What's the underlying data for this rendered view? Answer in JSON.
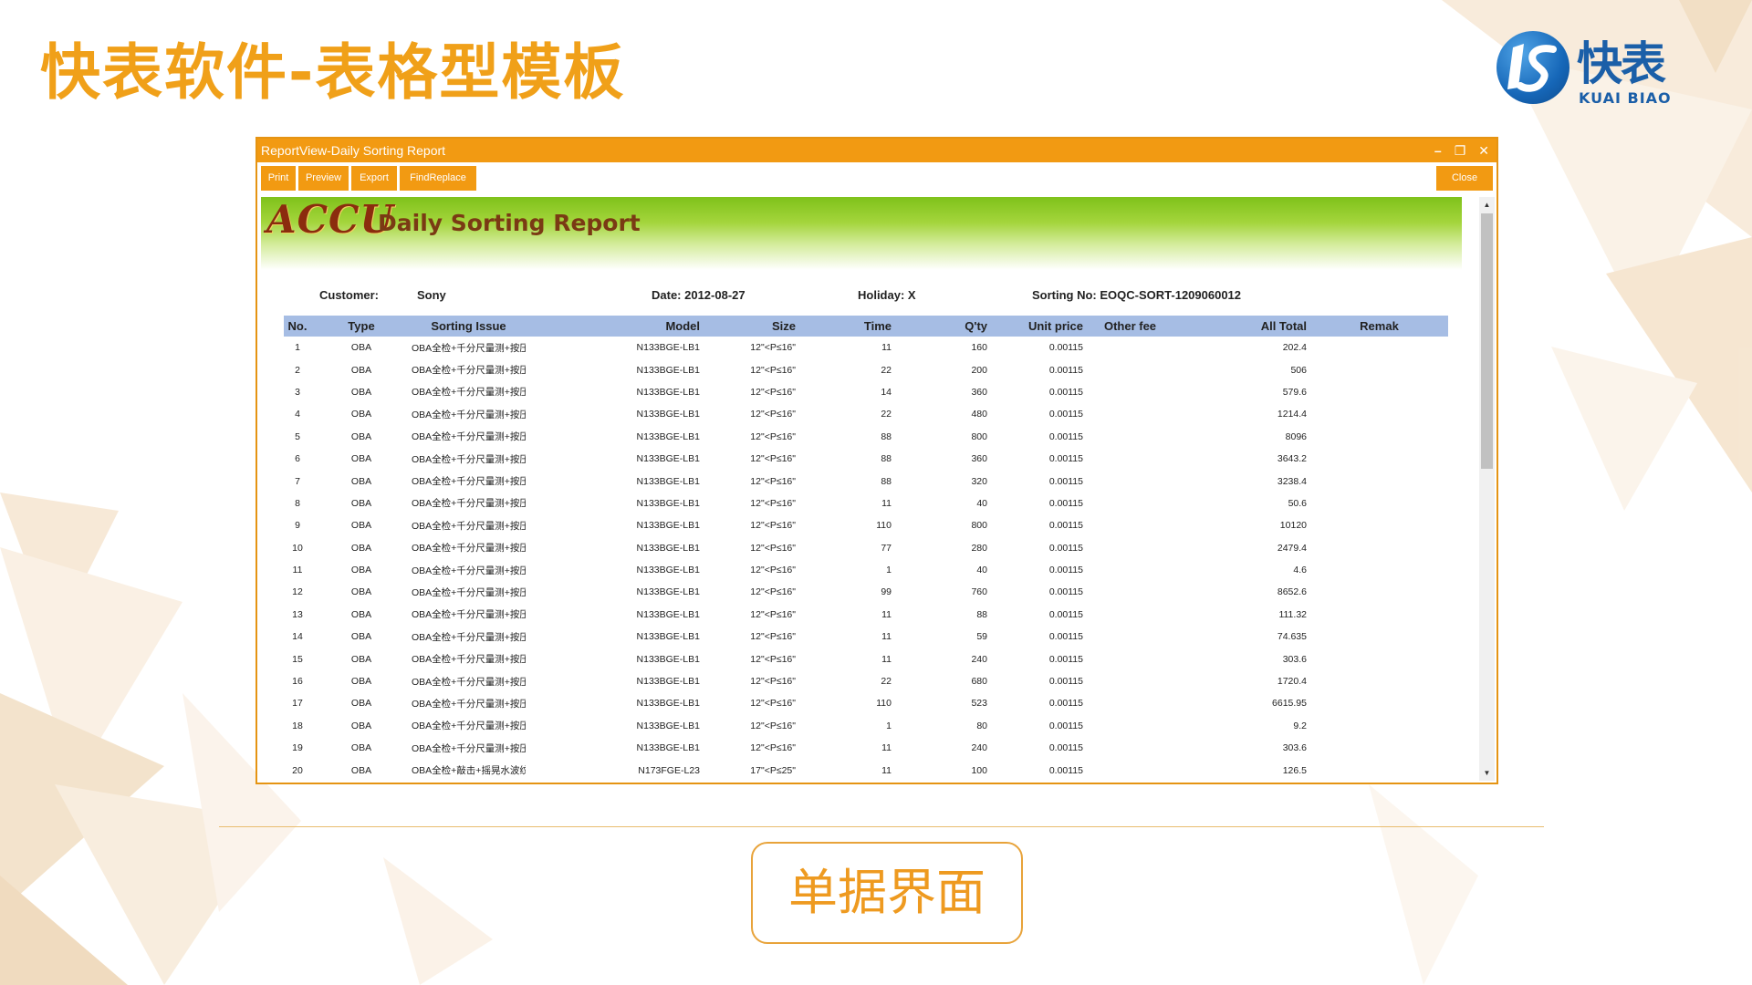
{
  "slide": {
    "title": "快表软件-表格型模板",
    "caption": "单据界面",
    "logo": {
      "name_cn": "快表",
      "name_en": "KUAI BIAO"
    }
  },
  "window": {
    "title": "ReportView-Daily Sorting Report",
    "controls": {
      "minimize": "–",
      "restore": "❐",
      "close": "✕"
    }
  },
  "toolbar": {
    "print": "Print",
    "preview": "Preview",
    "export": "Export",
    "findreplace": "FindReplace",
    "close": "Close"
  },
  "report": {
    "brand": "ACCU",
    "title": "Daily Sorting Report",
    "customer_label": "Customer:",
    "customer_value": "Sony",
    "date": "Date: 2012-08-27",
    "holiday": "Holiday: X",
    "sorting_no": "Sorting No: EOQC-SORT-1209060012"
  },
  "table": {
    "columns": [
      "No.",
      "Type",
      "Sorting Issue",
      "Model",
      "Size",
      "Time",
      "Q'ty",
      "Unit price",
      "Other fee",
      "All Total",
      "Remak"
    ],
    "rows": [
      [
        "1",
        "OBA",
        "OBA全检+千分尺量测+按压",
        "N133BGE-LB1",
        "12\"<P≤16\"",
        "11",
        "160",
        "0.00115",
        "",
        "202.4",
        ""
      ],
      [
        "2",
        "OBA",
        "OBA全检+千分尺量测+按压",
        "N133BGE-LB1",
        "12\"<P≤16\"",
        "22",
        "200",
        "0.00115",
        "",
        "506",
        ""
      ],
      [
        "3",
        "OBA",
        "OBA全检+千分尺量测+按压",
        "N133BGE-LB1",
        "12\"<P≤16\"",
        "14",
        "360",
        "0.00115",
        "",
        "579.6",
        ""
      ],
      [
        "4",
        "OBA",
        "OBA全检+千分尺量测+按压",
        "N133BGE-LB1",
        "12\"<P≤16\"",
        "22",
        "480",
        "0.00115",
        "",
        "1214.4",
        ""
      ],
      [
        "5",
        "OBA",
        "OBA全检+千分尺量测+按压",
        "N133BGE-LB1",
        "12\"<P≤16\"",
        "88",
        "800",
        "0.00115",
        "",
        "8096",
        ""
      ],
      [
        "6",
        "OBA",
        "OBA全检+千分尺量测+按压",
        "N133BGE-LB1",
        "12\"<P≤16\"",
        "88",
        "360",
        "0.00115",
        "",
        "3643.2",
        ""
      ],
      [
        "7",
        "OBA",
        "OBA全检+千分尺量测+按压",
        "N133BGE-LB1",
        "12\"<P≤16\"",
        "88",
        "320",
        "0.00115",
        "",
        "3238.4",
        ""
      ],
      [
        "8",
        "OBA",
        "OBA全检+千分尺量测+按压",
        "N133BGE-LB1",
        "12\"<P≤16\"",
        "11",
        "40",
        "0.00115",
        "",
        "50.6",
        ""
      ],
      [
        "9",
        "OBA",
        "OBA全检+千分尺量测+按压",
        "N133BGE-LB1",
        "12\"<P≤16\"",
        "110",
        "800",
        "0.00115",
        "",
        "10120",
        ""
      ],
      [
        "10",
        "OBA",
        "OBA全检+千分尺量测+按压",
        "N133BGE-LB1",
        "12\"<P≤16\"",
        "77",
        "280",
        "0.00115",
        "",
        "2479.4",
        ""
      ],
      [
        "11",
        "OBA",
        "OBA全检+千分尺量测+按压",
        "N133BGE-LB1",
        "12\"<P≤16\"",
        "1",
        "40",
        "0.00115",
        "",
        "4.6",
        ""
      ],
      [
        "12",
        "OBA",
        "OBA全检+千分尺量测+按压",
        "N133BGE-LB1",
        "12\"<P≤16\"",
        "99",
        "760",
        "0.00115",
        "",
        "8652.6",
        ""
      ],
      [
        "13",
        "OBA",
        "OBA全检+千分尺量测+按压",
        "N133BGE-LB1",
        "12\"<P≤16\"",
        "11",
        "88",
        "0.00115",
        "",
        "111.32",
        ""
      ],
      [
        "14",
        "OBA",
        "OBA全检+千分尺量测+按压",
        "N133BGE-LB1",
        "12\"<P≤16\"",
        "11",
        "59",
        "0.00115",
        "",
        "74.635",
        ""
      ],
      [
        "15",
        "OBA",
        "OBA全检+千分尺量测+按压",
        "N133BGE-LB1",
        "12\"<P≤16\"",
        "11",
        "240",
        "0.00115",
        "",
        "303.6",
        ""
      ],
      [
        "16",
        "OBA",
        "OBA全检+千分尺量测+按压",
        "N133BGE-LB1",
        "12\"<P≤16\"",
        "22",
        "680",
        "0.00115",
        "",
        "1720.4",
        ""
      ],
      [
        "17",
        "OBA",
        "OBA全检+千分尺量测+按压",
        "N133BGE-LB1",
        "12\"<P≤16\"",
        "110",
        "523",
        "0.00115",
        "",
        "6615.95",
        ""
      ],
      [
        "18",
        "OBA",
        "OBA全检+千分尺量测+按压",
        "N133BGE-LB1",
        "12\"<P≤16\"",
        "1",
        "80",
        "0.00115",
        "",
        "9.2",
        ""
      ],
      [
        "19",
        "OBA",
        "OBA全检+千分尺量测+按压",
        "N133BGE-LB1",
        "12\"<P≤16\"",
        "11",
        "240",
        "0.00115",
        "",
        "303.6",
        ""
      ],
      [
        "20",
        "OBA",
        "OBA全检+敲击+摇晃水波纹",
        "N173FGE-L23",
        "17\"<P≤25\"",
        "11",
        "100",
        "0.00115",
        "",
        "126.5",
        ""
      ]
    ]
  },
  "colors": {
    "accent": "#f29a12",
    "title_text": "#f0a019",
    "header_bg": "#a6bde4",
    "logo_blue": "#1b5fa8"
  },
  "icons": {
    "minimize": "minimize-icon",
    "restore": "restore-icon",
    "close": "close-icon",
    "scroll_up": "scroll-up-arrow-icon",
    "scroll_down": "scroll-down-arrow-icon"
  }
}
